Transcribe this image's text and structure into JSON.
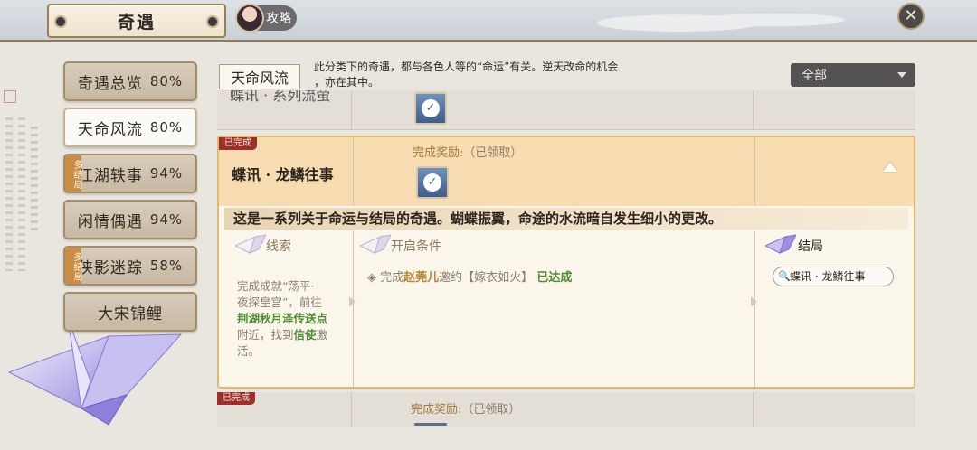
{
  "header": {
    "title": "奇遇",
    "guide_label": "攻略",
    "close_icon": "close-icon"
  },
  "tabs": [
    {
      "label": "奇遇总览",
      "percent": "80%",
      "active": false,
      "multi": ""
    },
    {
      "label": "天命风流",
      "percent": "80%",
      "active": true,
      "multi": ""
    },
    {
      "label": "江湖轶事",
      "percent": "94%",
      "active": false,
      "multi": "多结局"
    },
    {
      "label": "闲情偶遇",
      "percent": "94%",
      "active": false,
      "multi": ""
    },
    {
      "label": "侠影迷踪",
      "percent": "58%",
      "active": false,
      "multi": "多结局"
    },
    {
      "label": "大宋锦鲤",
      "percent": "",
      "active": false,
      "multi": ""
    }
  ],
  "category": {
    "label": "天命风流",
    "description_line1": "此分类下的奇遇，都与各色人等的“命运”有关。逆天改命的机会",
    "description_line2": "，亦在其中。"
  },
  "filter": {
    "selected": "全部"
  },
  "prev_row": {
    "name": "蝶讯 · 系列流萤"
  },
  "card": {
    "badge": "已完成",
    "name": "蝶讯 · 龙鳞往事",
    "reward_label": "完成奖励:",
    "reward_status": "（已领取）",
    "description": "这是一系列关于命运与结局的奇遇。蝴蝶振翼，命途的水流暗自发生细小的更改。",
    "clue_title": "线索",
    "condition_title": "开启条件",
    "ending_title": "结局",
    "clue": {
      "line1": "完成成就“荡平·",
      "line2": "夜探皇宫”，前往",
      "place": "荆湖秋月泽传送点",
      "line3_pre": "附近，找到",
      "npc": "信使",
      "line3_post": "激",
      "line4": "活。"
    },
    "condition": {
      "prefix": "完成",
      "who": "赵莞儿",
      "mid": "邀约【嫁衣如火】",
      "status": "已达成"
    },
    "ending_chip": "蝶讯 · 龙鳞往事"
  },
  "next_row": {
    "badge": "已完成",
    "reward_label": "完成奖励:",
    "reward_status": "（已领取）"
  },
  "colors": {
    "accent_gold": "#e2b86a",
    "badge_red": "#9c2f2a",
    "success_green": "#4e8a33",
    "multi_orange": "#c98d46"
  }
}
